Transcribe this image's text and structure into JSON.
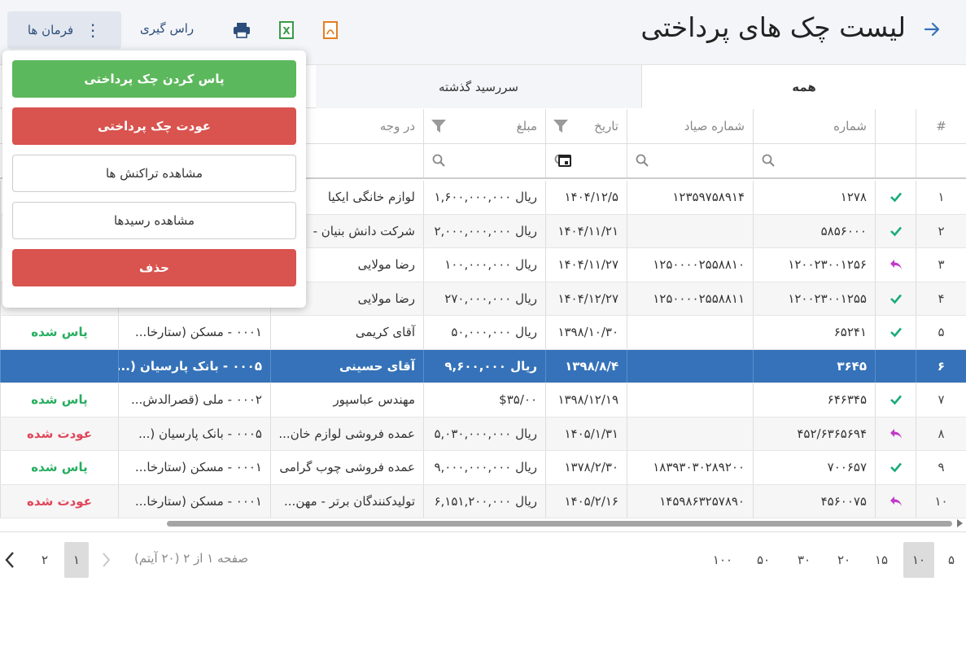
{
  "header": {
    "title": "لیست چک های پرداختی",
    "commands_label": "فرمان ها",
    "breakeven_label": "راس گیری"
  },
  "tabs": [
    {
      "label": "همه"
    },
    {
      "label": "سررسید گذشته"
    }
  ],
  "columns": {
    "idx": "#",
    "number": "شماره",
    "sayad": "شماره صیاد",
    "date": "تاریخ",
    "amount": "مبلغ",
    "payee": "در وجه"
  },
  "rows": [
    {
      "idx": "۱",
      "icon": "check",
      "number": "۱۲۷۸",
      "sayad": "۱۲۳۵۹۷۵۸۹۱۴",
      "date": "۱۴۰۴/۱۲/۵",
      "amount": "ریال ۱,۶۰۰,۰۰۰,۰۰۰",
      "payee": "لوازم خانگی ایکیا",
      "bank": "",
      "status": ""
    },
    {
      "idx": "۲",
      "icon": "check",
      "number": "۵۸۵۶۰۰۰",
      "sayad": "",
      "date": "۱۴۰۴/۱۱/۲۱",
      "amount": "ریال ۲,۰۰۰,۰۰۰,۰۰۰",
      "payee": "شرکت دانش بنیان -",
      "bank": "",
      "status": ""
    },
    {
      "idx": "۳",
      "icon": "return",
      "number": "۱۲۰۰۲۳۰۰۱۲۵۶",
      "sayad": "۱۲۵۰۰۰۰۲۵۵۸۸۱۰",
      "date": "۱۴۰۴/۱۱/۲۷",
      "amount": "ریال ۱۰۰,۰۰۰,۰۰۰",
      "payee": "رضا مولایی",
      "bank": "",
      "status": ""
    },
    {
      "idx": "۴",
      "icon": "check",
      "number": "۱۲۰۰۲۳۰۰۱۲۵۵",
      "sayad": "۱۲۵۰۰۰۰۲۵۵۸۸۱۱",
      "date": "۱۴۰۴/۱۲/۲۷",
      "amount": "ریال ۲۷۰,۰۰۰,۰۰۰",
      "payee": "رضا مولایی",
      "bank": "",
      "status": ""
    },
    {
      "idx": "۵",
      "icon": "check",
      "number": "۶۵۲۴۱",
      "sayad": "",
      "date": "۱۳۹۸/۱۰/۳۰",
      "amount": "ریال ۵۰,۰۰۰,۰۰۰",
      "payee": "آقای کریمی",
      "bank": "۰۰۰۱ - مسکن (ستارخا...",
      "status": "پاس شده",
      "status_type": "green"
    },
    {
      "idx": "۶",
      "icon": "",
      "number": "۳۶۴۵",
      "sayad": "",
      "date": "۱۳۹۸/۸/۴",
      "amount": "ریال ۹,۶۰۰,۰۰۰",
      "payee": "آقای حسینی",
      "bank": "۰۰۰۵ - بانک پارسیان (...",
      "status": "",
      "selected": true
    },
    {
      "idx": "۷",
      "icon": "check",
      "number": "۶۴۶۳۴۵",
      "sayad": "",
      "date": "۱۳۹۸/۱۲/۱۹",
      "amount": "$۳۵/۰۰",
      "payee": "مهندس عباسپور",
      "bank": "۰۰۰۲ - ملی (قصرالدش...",
      "status": "پاس شده",
      "status_type": "green"
    },
    {
      "idx": "۸",
      "icon": "return",
      "number": "۴۵۲/۶۳۶۵۶۹۴",
      "sayad": "",
      "date": "۱۴۰۵/۱/۳۱",
      "amount": "ریال ۵,۰۳۰,۰۰۰,۰۰۰",
      "payee": "عمده فروشی لوازم خان...",
      "bank": "۰۰۰۵ - بانک پارسیان (...",
      "status": "عودت شده",
      "status_type": "red"
    },
    {
      "idx": "۹",
      "icon": "check",
      "number": "۷۰۰۶۵۷",
      "sayad": "۱۸۳۹۳۰۳۰۲۸۹۲۰۰",
      "date": "۱۳۷۸/۲/۳۰",
      "amount": "ریال ۹,۰۰۰,۰۰۰,۰۰۰",
      "payee": "عمده فروشی چوب گرامی",
      "bank": "۰۰۰۱ - مسکن (ستارخا...",
      "status": "پاس شده",
      "status_type": "green"
    },
    {
      "idx": "۱۰",
      "icon": "return",
      "number": "۴۵۶۰۰۷۵",
      "sayad": "۱۴۵۹۸۶۳۲۵۷۸۹۰",
      "date": "۱۴۰۵/۲/۱۶",
      "amount": "ریال ۶,۱۵۱,۲۰۰,۰۰۰",
      "payee": "تولیدکنندگان برتر - مهن...",
      "bank": "۰۰۰۱ - مسکن (ستارخا...",
      "status": "عودت شده",
      "status_type": "red"
    }
  ],
  "pager": {
    "sizes": [
      "۵",
      "۱۰",
      "۱۵",
      "۲۰",
      "۳۰",
      "۵۰",
      "۱۰۰"
    ],
    "active_size": "۱۰",
    "info": "صفحه ۱ از ۲ (۲۰ آیتم)",
    "pages": [
      "۱",
      "۲"
    ],
    "active_page": "۱"
  },
  "menu": {
    "pass": "پاس کردن چک پرداختی",
    "return": "عودت چک پرداختی",
    "transactions": "مشاهده تراکنش ها",
    "receipts": "مشاهده رسیدها",
    "delete": "حذف"
  },
  "colors": {
    "selected_row": "#3572b9",
    "status_green": "#27ae60",
    "status_red": "#e0465a",
    "menu_green": "#5cb85c",
    "menu_red": "#d9534f",
    "check_icon": "#1aaa7a",
    "return_icon": "#c23ac9"
  },
  "icons": {
    "back": "arrow-right-icon",
    "print": "printer-icon",
    "excel": "excel-icon",
    "pdf": "pdf-icon",
    "filter": "funnel-icon",
    "search": "magnifier-icon",
    "calendar": "calendar-icon"
  }
}
